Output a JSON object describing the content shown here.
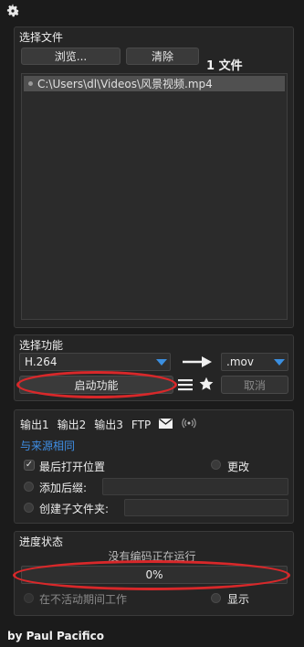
{
  "files": {
    "title": "选择文件",
    "browse_label": "浏览...",
    "clear_label": "清除",
    "count_label": "1 文件",
    "items": [
      "C:\\Users\\dl\\Videos\\风景视频.mp4"
    ]
  },
  "function": {
    "title": "选择功能",
    "codec_value": "H.264",
    "format_value": ".mov",
    "start_label": "启动功能",
    "cancel_label": "取消"
  },
  "output": {
    "tabs": [
      "输出1",
      "输出2",
      "输出3",
      "FTP"
    ],
    "same_as_source": "与来源相同",
    "open_location_label": "最后打开位置",
    "change_label": "更改",
    "suffix_label": "添加后缀:",
    "subfolder_label": "创建子文件夹:"
  },
  "progress": {
    "title": "进度状态",
    "status_text": "没有编码正在运行",
    "percent": "0%",
    "inactive_label": "在不活动期间工作",
    "show_label": "显示"
  },
  "footer": {
    "credit": "by Paul Pacifico"
  },
  "icons": {
    "settings": "gear-icon",
    "arrow": "arrow-right-icon",
    "menu": "hamburger-icon",
    "favorite": "star-icon",
    "mail": "mail-icon",
    "broadcast": "broadcast-icon"
  },
  "colors": {
    "accent": "#3b8fe0",
    "highlight_oval": "#d8282a"
  }
}
